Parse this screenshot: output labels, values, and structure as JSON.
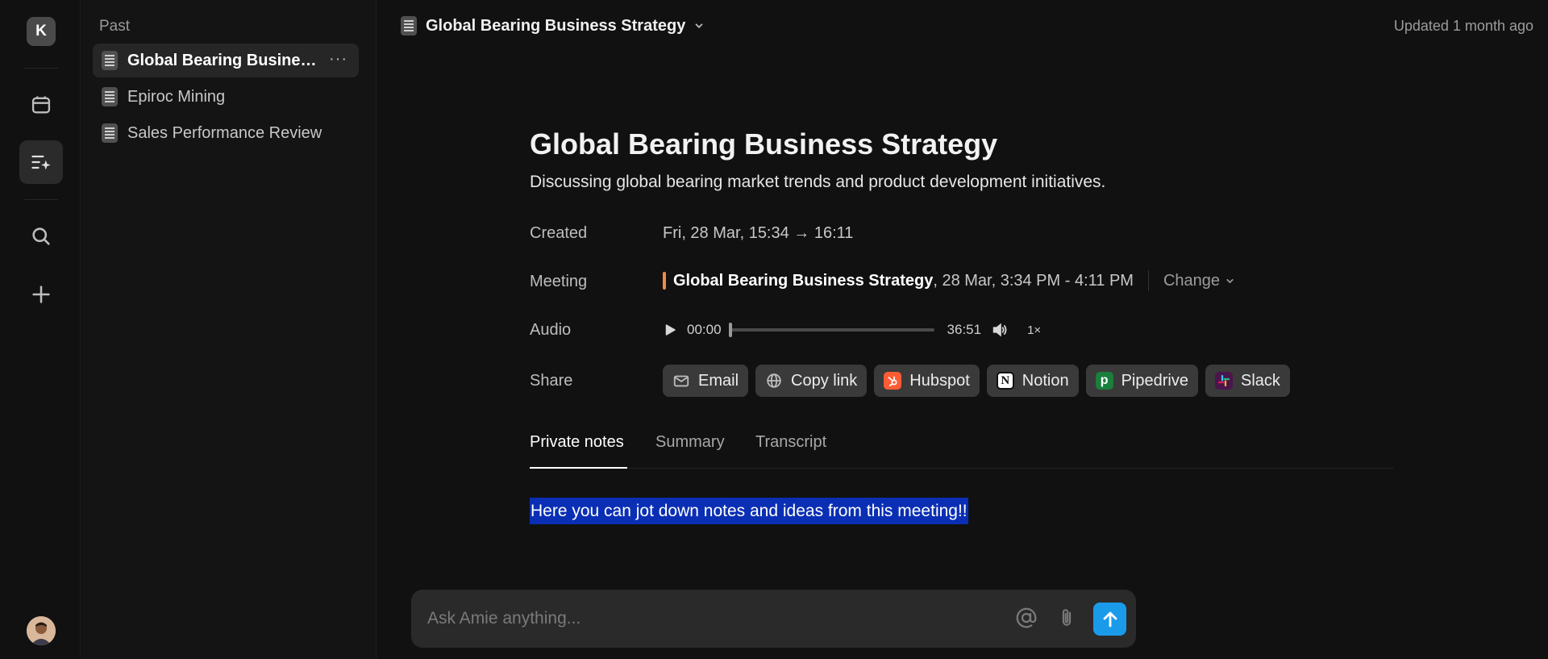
{
  "workspace": {
    "initial": "K"
  },
  "sidebar": {
    "heading": "Past",
    "items": [
      {
        "label": "Global Bearing Business...",
        "active": true
      },
      {
        "label": "Epiroc Mining",
        "active": false
      },
      {
        "label": "Sales Performance Review",
        "active": false
      }
    ],
    "more_label": "···"
  },
  "header": {
    "title": "Global Bearing Business Strategy",
    "updated": "Updated 1 month ago"
  },
  "doc": {
    "title": "Global Bearing Business Strategy",
    "subtitle": "Discussing global bearing market trends and product development initiatives.",
    "created_label": "Created",
    "created_value": "Fri, 28 Mar, 15:34 → 16:11",
    "meeting_label": "Meeting",
    "meeting_name": "Global Bearing Business Strategy",
    "meeting_time": ", 28 Mar, 3:34 PM - 4:11 PM",
    "meeting_change": "Change",
    "meeting_color": "#ef8a4a",
    "audio_label": "Audio",
    "audio_current": "00:00",
    "audio_total": "36:51",
    "audio_speed": "1×",
    "audio_progress": 0,
    "share_label": "Share",
    "share_buttons": [
      {
        "label": "Email",
        "icon": "mail-icon"
      },
      {
        "label": "Copy link",
        "icon": "globe-icon"
      },
      {
        "label": "Hubspot",
        "icon": "hubspot-icon",
        "color": "#ff5c35"
      },
      {
        "label": "Notion",
        "icon": "notion-icon",
        "color": "#ffffff"
      },
      {
        "label": "Pipedrive",
        "icon": "pipedrive-icon",
        "color": "#1a7f3c"
      },
      {
        "label": "Slack",
        "icon": "slack-icon",
        "color": "#4a154b"
      }
    ]
  },
  "tabs": [
    {
      "label": "Private notes",
      "active": true
    },
    {
      "label": "Summary",
      "active": false
    },
    {
      "label": "Transcript",
      "active": false
    }
  ],
  "notes": {
    "text": "Here you can jot down notes and ideas from this meeting!!"
  },
  "chat": {
    "placeholder": "Ask Amie anything...",
    "value": ""
  },
  "colors": {
    "send": "#1a9bea",
    "selection": "#0a2fb5"
  }
}
